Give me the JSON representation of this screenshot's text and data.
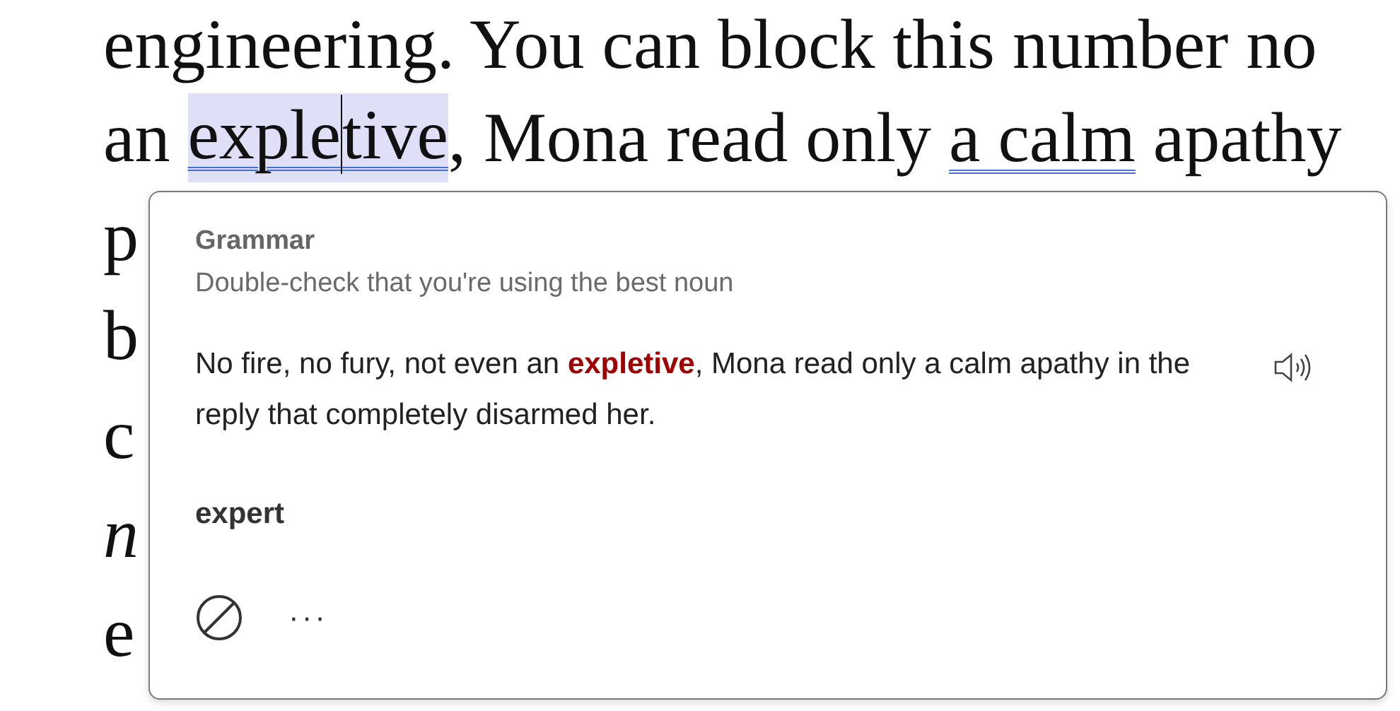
{
  "document": {
    "lines": [
      {
        "kind": "full",
        "segments": [
          {
            "kind": "plain",
            "text": "engineering. You can block this number no"
          }
        ]
      },
      {
        "kind": "full",
        "segments": [
          {
            "kind": "plain",
            "text": "an "
          },
          {
            "kind": "flagged",
            "selected": true,
            "caret": true,
            "parts": [
              "exple",
              "tive"
            ]
          },
          {
            "kind": "plain",
            "text": ", Mona read only "
          },
          {
            "kind": "flagged",
            "selected": false,
            "caret": false,
            "parts": [
              "a calm"
            ]
          },
          {
            "kind": "plain",
            "text": " apathy"
          }
        ]
      },
      {
        "kind": "covered",
        "start": "p",
        "italic": false
      },
      {
        "kind": "covered",
        "start": "b",
        "italic": false
      },
      {
        "kind": "covered",
        "start": "c",
        "italic": false
      },
      {
        "kind": "covered",
        "start": "n",
        "italic": true
      },
      {
        "kind": "covered",
        "start": "e",
        "italic": false
      }
    ]
  },
  "suggestion_card": {
    "category": "Grammar",
    "description": "Double-check that you're using the best noun",
    "sentence": "No fire, no fury, not even an **expletive**, Mona read only a calm apathy in the reply that completely disarmed her.",
    "suggestions": [
      "expert"
    ],
    "actions": [
      {
        "kind": "ignore"
      },
      {
        "kind": "more",
        "label": "···"
      }
    ]
  }
}
